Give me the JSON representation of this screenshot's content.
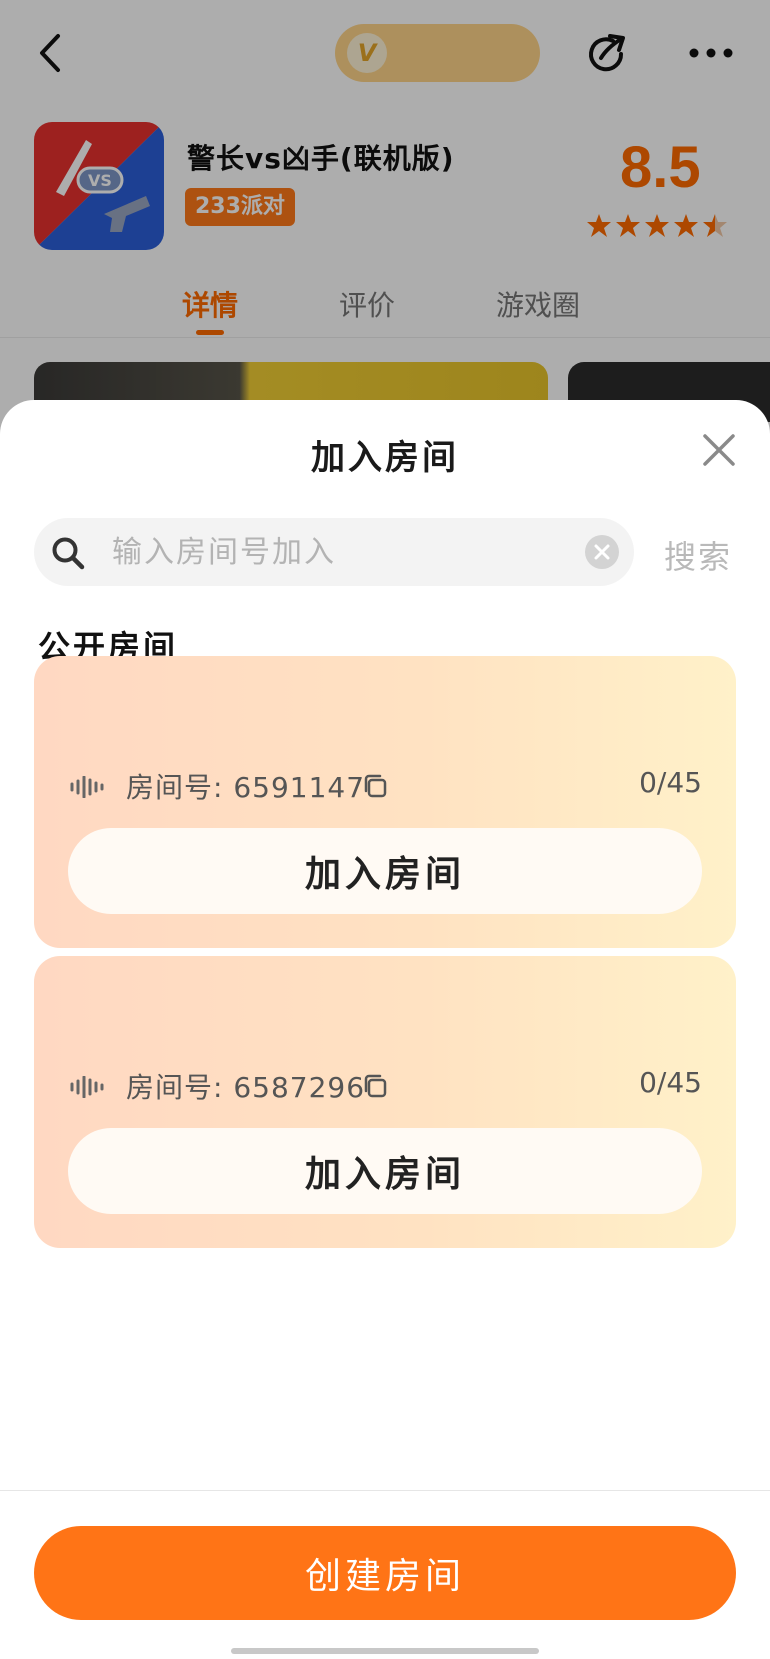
{
  "game": {
    "name": "警长vs凶手(联机版)",
    "badge": "233派对",
    "score": "8.5",
    "rating_stars": 4.5,
    "icon_text": "VS"
  },
  "tabs": [
    {
      "label": "详情",
      "active": true
    },
    {
      "label": "评价",
      "active": false
    },
    {
      "label": "游戏圈",
      "active": false
    }
  ],
  "sheet": {
    "title": "加入房间",
    "search": {
      "placeholder": "输入房间号加入",
      "value": "",
      "button_label": "搜索"
    },
    "section_title": "公开房间",
    "rooms": [
      {
        "label": "房间号: 6591147",
        "count": "0/45",
        "join_label": "加入房间"
      },
      {
        "label": "房间号: 6587296",
        "count": "0/45",
        "join_label": "加入房间"
      }
    ],
    "create_label": "创建房间"
  },
  "colors": {
    "accent": "#ff6a00",
    "create_button": "#ff7416",
    "card_gradient_start": "#ffd8c2",
    "card_gradient_end": "#fff1c9"
  },
  "icons": [
    "back-arrow-icon",
    "vip-icon",
    "share-icon",
    "more-icon",
    "close-icon",
    "search-icon",
    "clear-icon",
    "audio-wave-icon",
    "copy-icon"
  ]
}
